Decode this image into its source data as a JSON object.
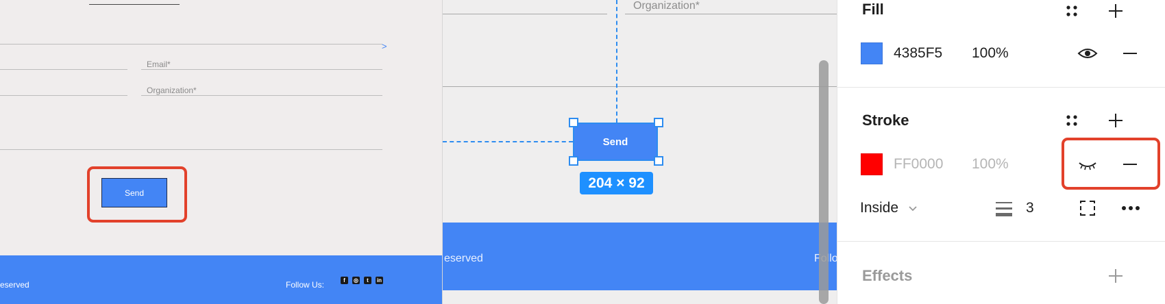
{
  "canvas": {
    "field_label_top": "Organization*",
    "send_label": "Send",
    "dimensions": "204 × 92",
    "footer_left_text": "eserved",
    "footer_right_text": "Follo"
  },
  "preview": {
    "email_label": "Email*",
    "organization_label": "Organization*",
    "chevron": ">",
    "send_label": "Send",
    "footer_left_text": "eserved",
    "footer_follow_text": "Follow Us:",
    "social_icons": [
      "facebook-icon",
      "instagram-icon",
      "twitter-icon",
      "linkedin-icon"
    ],
    "social_glyphs": [
      "f",
      "◎",
      "t",
      "in"
    ]
  },
  "inspector": {
    "fill": {
      "title": "Fill",
      "hex": "4385F5",
      "opacity": "100%",
      "color": "#4385F5"
    },
    "stroke": {
      "title": "Stroke",
      "hex": "FF0000",
      "opacity": "100%",
      "color": "#FF0000",
      "position": "Inside",
      "weight": "3"
    },
    "effects": {
      "title": "Effects"
    }
  },
  "colors": {
    "accent": "#4385F5",
    "selection": "#2D8CF0",
    "highlight": "#E2412B"
  }
}
